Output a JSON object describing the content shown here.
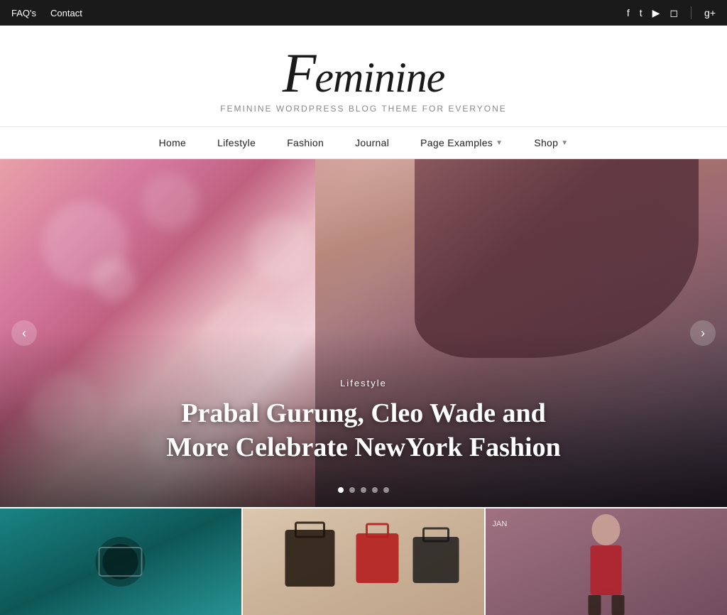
{
  "topbar": {
    "links": [
      {
        "label": "FAQ's",
        "href": "#"
      },
      {
        "label": "Contact",
        "href": "#"
      }
    ],
    "social": [
      {
        "name": "facebook-icon",
        "glyph": "f"
      },
      {
        "name": "twitter-icon",
        "glyph": "t"
      },
      {
        "name": "youtube-icon",
        "glyph": "▶"
      },
      {
        "name": "instagram-icon",
        "glyph": "◻"
      },
      {
        "name": "google-plus-icon",
        "glyph": "g+"
      }
    ]
  },
  "header": {
    "logo": "Feminine",
    "tagline": "Feminine WordPress Blog Theme For Everyone"
  },
  "nav": {
    "items": [
      {
        "label": "Home",
        "dropdown": false
      },
      {
        "label": "Lifestyle",
        "dropdown": false
      },
      {
        "label": "Fashion",
        "dropdown": false
      },
      {
        "label": "Journal",
        "dropdown": false
      },
      {
        "label": "Page Examples",
        "dropdown": true
      },
      {
        "label": "Shop",
        "dropdown": true
      }
    ]
  },
  "hero": {
    "category": "Lifestyle",
    "title": "Prabal Gurung, Cleo Wade and\nMore Celebrate NewYork Fashion",
    "dots": [
      true,
      false,
      false,
      false,
      false
    ]
  },
  "cards": [
    {
      "theme": "teal"
    },
    {
      "theme": "bags"
    },
    {
      "theme": "fashion"
    }
  ]
}
